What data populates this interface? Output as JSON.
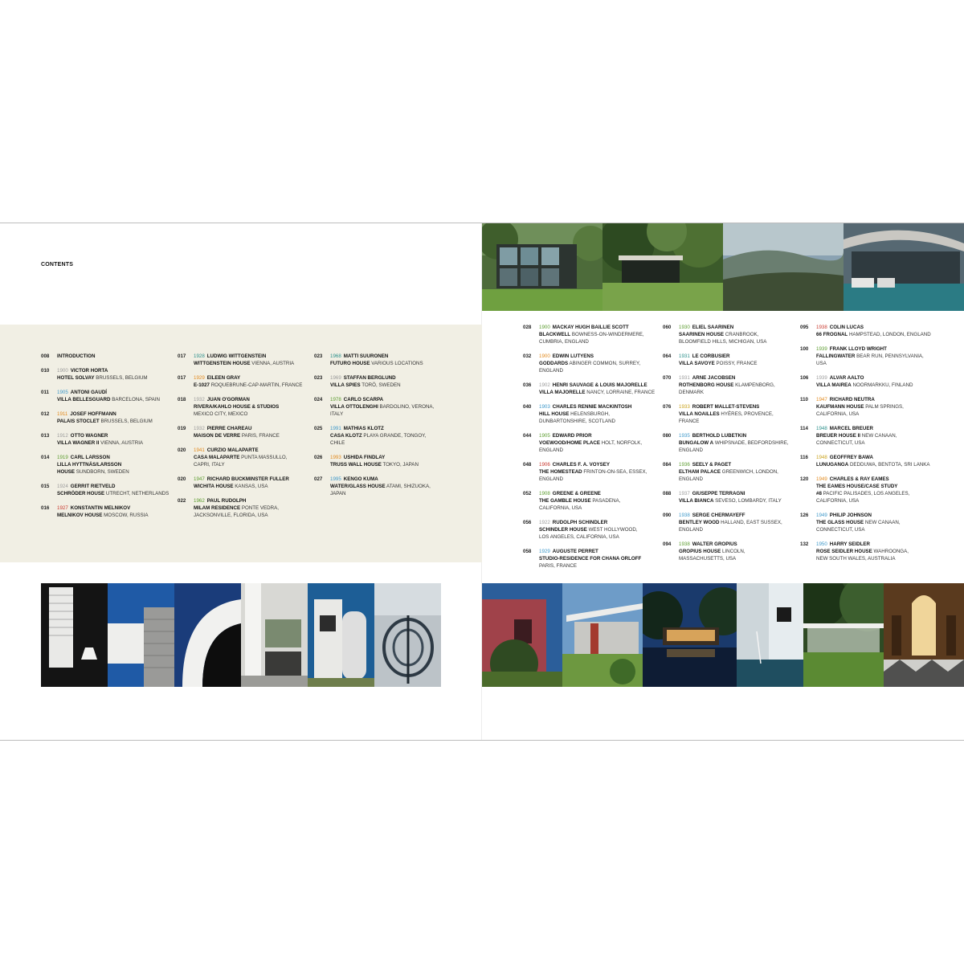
{
  "page": {
    "heading": "CONTENTS"
  },
  "colors": {
    "green": "#5a9b2d",
    "orange": "#e28a1e",
    "blue": "#3c97c9",
    "grey": "#9a9a9a",
    "red": "#c8372d",
    "teal": "#2a8f8a",
    "yellow": "#c9a21a",
    "beige": "#f1efe4"
  },
  "toc_left": {
    "col1": [
      {
        "page": "008",
        "name": "INTRODUCTION"
      },
      {
        "page": "010",
        "year": "1900",
        "yc": "grey",
        "name": "VICTOR HORTA",
        "house": "HOTEL SOLVAY",
        "loc": "BRUSSELS, BELGIUM"
      },
      {
        "page": "011",
        "year": "1905",
        "yc": "blue",
        "name": "ANTONI GAUDÍ",
        "house": "VILLA BELLESGUARD",
        "loc": "BARCELONA, SPAIN"
      },
      {
        "page": "012",
        "year": "1911",
        "yc": "orange",
        "name": "JOSEF HOFFMANN",
        "house": "PALAIS STOCLET",
        "loc": "BRUSSELS, BELGIUM"
      },
      {
        "page": "013",
        "year": "1912",
        "yc": "grey",
        "name": "OTTO WAGNER",
        "house": "VILLA WAGNER II",
        "loc": "VIENNA, AUSTRIA"
      },
      {
        "page": "014",
        "year": "1919",
        "yc": "green",
        "name": "CARL LARSSON",
        "house": "LILLA HYTTNÄS/LARSSON",
        "house2": "HOUSE",
        "loc": "SUNDBORN, SWEDEN"
      },
      {
        "page": "015",
        "year": "1924",
        "yc": "grey",
        "name": "GERRIT RIETVELD",
        "house": "SCHRÖDER HOUSE",
        "loc": "UTRECHT, NETHERLANDS"
      },
      {
        "page": "016",
        "year": "1927",
        "yc": "red",
        "name": "KONSTANTIN MELNIKOV",
        "house": "MELNIKOV HOUSE",
        "loc": "MOSCOW, RUSSIA"
      }
    ],
    "col2": [
      {
        "page": "017",
        "year": "1928",
        "yc": "teal",
        "name": "LUDWIG WITTGENSTEIN",
        "house": "WITTGENSTEIN HOUSE",
        "loc": "VIENNA, AUSTRIA"
      },
      {
        "page": "017",
        "year": "1929",
        "yc": "orange",
        "name": "EILEEN GRAY",
        "house": "E-1027",
        "loc": "ROQUEBRUNE-CAP-MARTIN, FRANCE"
      },
      {
        "page": "018",
        "year": "1932",
        "yc": "grey",
        "name": "JUAN O'GORMAN",
        "house": "RIVERA/KAHLO HOUSE & STUDIOS",
        "loc2": "MEXICO CITY, MEXICO"
      },
      {
        "page": "019",
        "year": "1932",
        "yc": "grey",
        "name": "PIERRE CHAREAU",
        "house": "MAISON DE VERRE",
        "loc": "PARIS, FRANCE"
      },
      {
        "page": "020",
        "year": "1941",
        "yc": "orange",
        "name": "CURZIO MALAPARTE",
        "house": "CASA MALAPARTE",
        "loc": "PUNTA MASSULLO,",
        "loc2": "CAPRI, ITALY"
      },
      {
        "page": "020",
        "year": "1947",
        "yc": "green",
        "name": "RICHARD BUCKMINSTER FULLER",
        "house": "WICHITA HOUSE",
        "loc": "KANSAS, USA"
      },
      {
        "page": "022",
        "year": "1962",
        "yc": "green",
        "name": "PAUL RUDOLPH",
        "house": "MILAM RESIDENCE",
        "loc": "PONTE VEDRA,",
        "loc2": "JACKSONVILLE, FLORIDA, USA"
      }
    ],
    "col3": [
      {
        "page": "023",
        "year": "1968",
        "yc": "teal",
        "name": "MATTI SUURONEN",
        "house": "FUTURO HOUSE",
        "loc": "VARIOUS LOCATIONS"
      },
      {
        "page": "023",
        "year": "1969",
        "yc": "grey",
        "name": "STAFFAN BERGLUND",
        "house": "VILLA SPIES",
        "loc": "TORÖ, SWEDEN"
      },
      {
        "page": "024",
        "year": "1978",
        "yc": "green",
        "name": "CARLO SCARPA",
        "house": "VILLA OTTOLENGHI",
        "loc": "BARDOLINO, VERONA,",
        "loc2": "ITALY"
      },
      {
        "page": "025",
        "year": "1991",
        "yc": "blue",
        "name": "MATHIAS KLOTZ",
        "house": "CASA KLOTZ",
        "loc": "PLAYA GRANDE, TONGOY,",
        "loc2": "CHILE"
      },
      {
        "page": "026",
        "year": "1993",
        "yc": "orange",
        "name": "USHIDA FINDLAY",
        "house": "TRUSS WALL HOUSE",
        "loc": "TOKYO, JAPAN"
      },
      {
        "page": "027",
        "year": "1995",
        "yc": "blue",
        "name": "KENGO KUMA",
        "house": "WATER/GLASS HOUSE",
        "loc": "ATAMI, SHIZUOKA,",
        "loc2": "JAPAN"
      }
    ]
  },
  "toc_right": {
    "col1": [
      {
        "page": "028",
        "year": "1900",
        "yc": "green",
        "name": "MACKAY HUGH BAILLIE SCOTT",
        "house": "BLACKWELL",
        "loc": "BOWNESS-ON-WINDERMERE,",
        "loc2": "CUMBRIA, ENGLAND"
      },
      {
        "page": "032",
        "year": "1900",
        "yc": "orange",
        "name": "EDWIN LUTYENS",
        "house": "GODDARDS",
        "loc": "ABINGER COMMON, SURREY,",
        "loc2": "ENGLAND"
      },
      {
        "page": "036",
        "year": "1902",
        "yc": "grey",
        "name": "HENRI SAUVAGE & LOUIS MAJORELLE",
        "house": "VILLA MAJORELLE",
        "loc": "NANCY, LORRAINE, FRANCE"
      },
      {
        "page": "040",
        "year": "1903",
        "yc": "blue",
        "name": "CHARLES RENNIE MACKINTOSH",
        "house": "HILL HOUSE",
        "loc": "HELENSBURGH,",
        "loc2": "DUNBARTONSHIRE, SCOTLAND"
      },
      {
        "page": "044",
        "year": "1905",
        "yc": "green",
        "name": "EDWARD PRIOR",
        "house": "VOEWOOD/HOME PLACE",
        "loc": "HOLT, NORFOLK,",
        "loc2": "ENGLAND"
      },
      {
        "page": "048",
        "year": "1906",
        "yc": "red",
        "name": "CHARLES F. A. VOYSEY",
        "house": "THE HOMESTEAD",
        "loc": "FRINTON-ON-SEA, ESSEX,",
        "loc2": "ENGLAND"
      },
      {
        "page": "052",
        "year": "1908",
        "yc": "green",
        "name": "GREENE & GREENE",
        "house": "THE GAMBLE HOUSE",
        "loc": "PASADENA,",
        "loc2": "CALIFORNIA, USA"
      },
      {
        "page": "056",
        "year": "1922",
        "yc": "grey",
        "name": "RUDOLPH SCHINDLER",
        "house": "SCHINDLER HOUSE",
        "loc": "WEST HOLLYWOOD,",
        "loc2": "LOS ANGELES, CALIFORNIA, USA"
      },
      {
        "page": "058",
        "year": "1929",
        "yc": "blue",
        "name": "AUGUSTE PERRET",
        "house": "STUDIO-RESIDENCE FOR CHANA ORLOFF",
        "loc2": "PARIS, FRANCE"
      }
    ],
    "col2": [
      {
        "page": "060",
        "year": "1930",
        "yc": "green",
        "name": "ELIEL SAARINEN",
        "house": "SAARINEN HOUSE",
        "loc": "CRANBROOK,",
        "loc2": "BLOOMFIELD HILLS, MICHIGAN, USA"
      },
      {
        "page": "064",
        "year": "1931",
        "yc": "teal",
        "name": "LE CORBUSIER",
        "house": "VILLA SAVOYE",
        "loc": "POISSY, FRANCE"
      },
      {
        "page": "070",
        "year": "1931",
        "yc": "grey",
        "name": "ARNE JACOBSEN",
        "house": "ROTHENBORG HOUSE",
        "loc": "KLAMPENBORG,",
        "loc2": "DENMARK"
      },
      {
        "page": "076",
        "year": "1933",
        "yc": "yellow",
        "name": "ROBERT MALLET-STEVENS",
        "house": "VILLA NOAILLES",
        "loc": "HYÈRES, PROVENCE,",
        "loc2": "FRANCE"
      },
      {
        "page": "080",
        "year": "1935",
        "yc": "blue",
        "name": "BERTHOLD LUBETKIN",
        "house": "BUNGALOW A",
        "loc": "WHIPSNADE, BEDFORDSHIRE,",
        "loc2": "ENGLAND"
      },
      {
        "page": "084",
        "year": "1936",
        "yc": "green",
        "name": "SEELY & PAGET",
        "house": "ELTHAM PALACE",
        "loc": "GREENWICH, LONDON,",
        "loc2": "ENGLAND"
      },
      {
        "page": "088",
        "year": "1937",
        "yc": "grey",
        "name": "GIUSEPPE TERRAGNI",
        "house": "VILLA BIANCA",
        "loc": "SEVESO, LOMBARDY, ITALY"
      },
      {
        "page": "090",
        "year": "1938",
        "yc": "blue",
        "name": "SERGE CHERMAYEFF",
        "house": "BENTLEY WOOD",
        "loc": "HALLAND, EAST SUSSEX,",
        "loc2": "ENGLAND"
      },
      {
        "page": "094",
        "year": "1938",
        "yc": "green",
        "name": "WALTER GROPIUS",
        "house": "GROPIUS HOUSE",
        "loc": "LINCOLN,",
        "loc2": "MASSACHUSETTS, USA"
      }
    ],
    "col3": [
      {
        "page": "095",
        "year": "1938",
        "yc": "red",
        "name": "COLIN LUCAS",
        "house": "66 FROGNAL",
        "loc": "HAMPSTEAD, LONDON, ENGLAND"
      },
      {
        "page": "100",
        "year": "1939",
        "yc": "green",
        "name": "FRANK LLOYD WRIGHT",
        "house": "FALLINGWATER",
        "loc": "BEAR RUN, PENNSYLVANIA,",
        "loc2": "USA"
      },
      {
        "page": "106",
        "year": "1939",
        "yc": "grey",
        "name": "ALVAR AALTO",
        "house": "VILLA MAIREA",
        "loc": "NOORMARKKU, FINLAND"
      },
      {
        "page": "110",
        "year": "1947",
        "yc": "orange",
        "name": "RICHARD NEUTRA",
        "house": "KAUFMANN HOUSE",
        "loc": "PALM SPRINGS,",
        "loc2": "CALIFORNIA, USA"
      },
      {
        "page": "114",
        "year": "1948",
        "yc": "teal",
        "name": "MARCEL BREUER",
        "house": "BREUER HOUSE II",
        "loc": "NEW CANAAN,",
        "loc2": "CONNECTICUT, USA"
      },
      {
        "page": "116",
        "year": "1948",
        "yc": "yellow",
        "name": "GEOFFREY BAWA",
        "house": "LUNUGANGA",
        "loc": "DEDDUWA, BENTOTA, SRI LANKA"
      },
      {
        "page": "120",
        "year": "1949",
        "yc": "orange",
        "name": "CHARLES & RAY EAMES",
        "house": "THE EAMES HOUSE/CASE STUDY",
        "house2": "#8",
        "loc": "PACIFIC PALISADES, LOS ANGELES,",
        "loc2": "CALIFORNIA, USA"
      },
      {
        "page": "126",
        "year": "1949",
        "yc": "blue",
        "name": "PHILIP JOHNSON",
        "house": "THE GLASS HOUSE",
        "loc": "NEW CANAAN,",
        "loc2": "CONNECTICUT, USA"
      },
      {
        "page": "132",
        "year": "1950",
        "yc": "blue",
        "name": "HARRY SEIDLER",
        "house": "ROSE SEIDLER HOUSE",
        "loc": "WAHROONGA,",
        "loc2": "NEW SOUTH WALES, AUSTRALIA"
      }
    ]
  },
  "photos": {
    "top_right": [
      "glass-box-house-in-garden",
      "pavilion-among-trees",
      "misty-hillside-landscape",
      "curved-roof-terrace-with-pool"
    ],
    "bottom_left": [
      "louvred-shutters-interior",
      "white-wall-blue-sky",
      "curved-white-form",
      "white-interior-columns",
      "white-cylindrical-villa",
      "spiral-stair-screen"
    ],
    "bottom_right": [
      "red-wall-building",
      "white-house-lawn",
      "house-reflected-in-pond",
      "white-wall-fountain",
      "glass-pavilion-in-woods",
      "arched-window-interior"
    ]
  }
}
